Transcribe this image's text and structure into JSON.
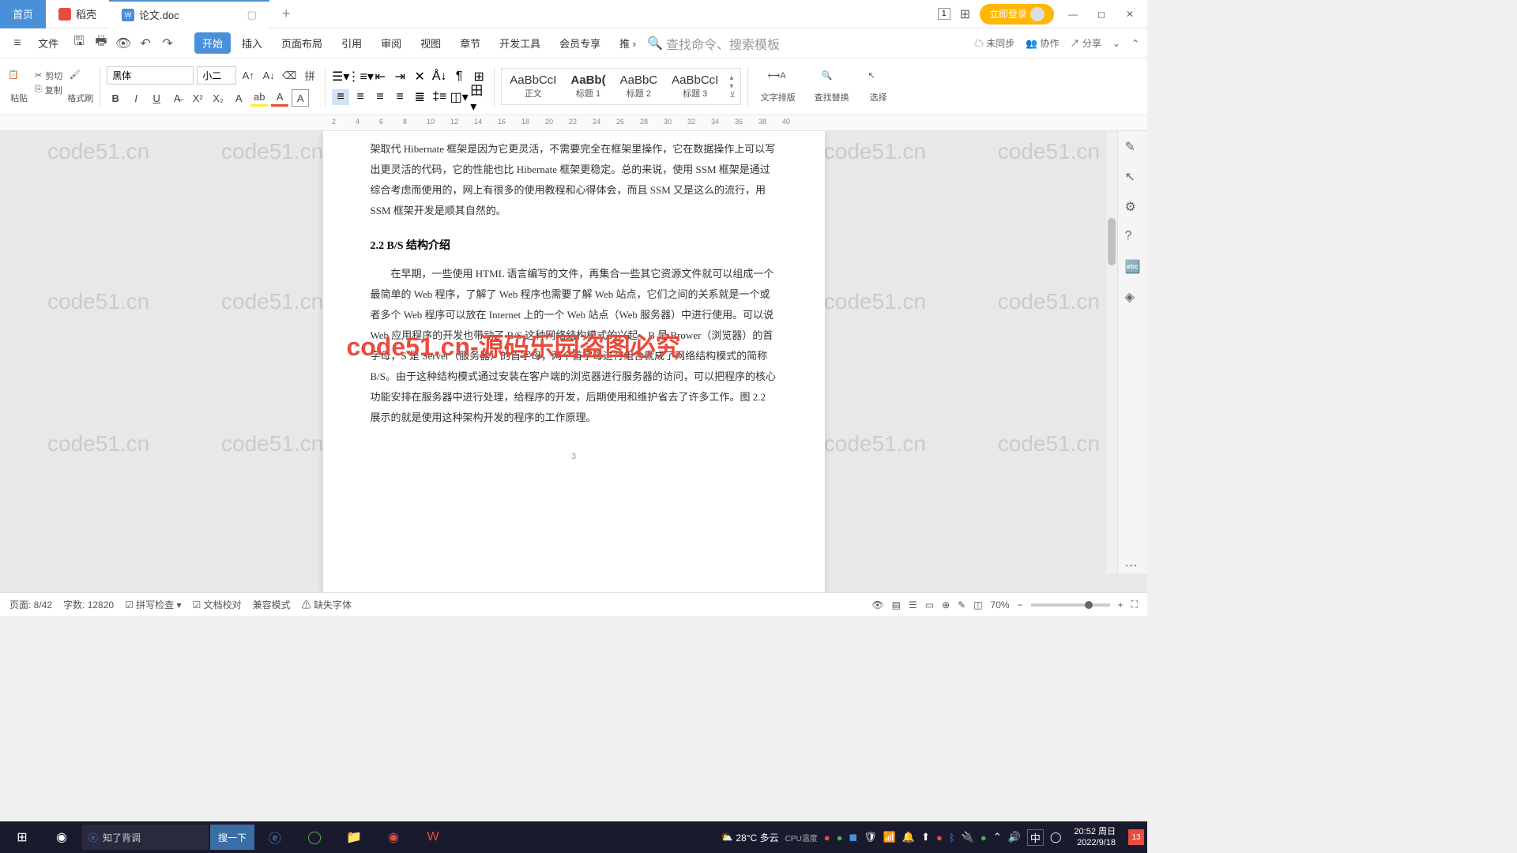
{
  "tabs": {
    "home": "首页",
    "shell": "稻壳",
    "doc": "论文.doc",
    "add": "+"
  },
  "titlebar": {
    "login": "立即登录",
    "window_mode": "1"
  },
  "menubar": {
    "hamburger": "≡",
    "file": "文件",
    "items": [
      "开始",
      "插入",
      "页面布局",
      "引用",
      "审阅",
      "视图",
      "章节",
      "开发工具",
      "会员专享",
      "推"
    ],
    "search_placeholder": "查找命令、搜索模板",
    "sync": "未同步",
    "collab": "协作",
    "share": "分享"
  },
  "ribbon": {
    "paste": "粘贴",
    "cut": "剪切",
    "copy": "复制",
    "format_painter": "格式刷",
    "font_name": "黑体",
    "font_size": "小二",
    "styles": [
      {
        "preview": "AaBbCcI",
        "label": "正文"
      },
      {
        "preview": "AaBb(",
        "label": "标题 1"
      },
      {
        "preview": "AaBbC",
        "label": "标题 2"
      },
      {
        "preview": "AaBbCcI",
        "label": "标题 3"
      }
    ],
    "text_layout": "文字排版",
    "find_replace": "查找替换",
    "select": "选择"
  },
  "ruler_ticks": [
    "2",
    "4",
    "6",
    "8",
    "10",
    "12",
    "14",
    "16",
    "18",
    "20",
    "22",
    "24",
    "26",
    "28",
    "30",
    "32",
    "34",
    "36",
    "38",
    "40"
  ],
  "document": {
    "intro_tail": "架取代 Hibernate 框架是因为它更灵活，不需要完全在框架里操作，它在数据操作上可以写出更灵活的代码，它的性能也比 Hibernate 框架更稳定。总的来说，使用 SSM 框架是通过综合考虑而使用的，网上有很多的使用教程和心得体会，而且 SSM 又是这么的流行，用 SSM 框架开发是顺其自然的。",
    "heading": "2.2 B/S 结构介绍",
    "para1": "在早期，一些使用 HTML 语言编写的文件，再集合一些其它资源文件就可以组成一个最简单的 Web 程序，了解了 Web 程序也需要了解 Web 站点，它们之间的关系就是一个或者多个 Web 程序可以放在 Internet 上的一个 Web 站点（Web 服务器）中进行使用。可以说 Web 应用程序的开发也带动了 B/S 这种网络结构模式的兴起。B 是 Brower（浏览器）的首字母，S 是 Server（服务器）的首字母，两个首字母进行组合就成了网络结构模式的简称 B/S。由于这种结构模式通过安装在客户端的浏览器进行服务器的访问，可以把程序的核心功能安排在服务器中进行处理，给程序的开发，后期使用和维护省去了许多工作。图 2.2 展示的就是使用这种架构开发的程序的工作原理。",
    "page_num": "3"
  },
  "watermark_text": "code51.cn",
  "watermark_red": "code51.cn-源码乐园盗图必究",
  "statusbar": {
    "page": "页面: 8/42",
    "words": "字数: 12820",
    "spell": "拼写检查",
    "proof": "文档校对",
    "compat": "兼容模式",
    "missing_font": "缺失字体",
    "zoom": "70%"
  },
  "taskbar": {
    "search_text": "知了背调",
    "search_btn": "搜一下",
    "weather_temp": "28°C",
    "weather_desc": "多云",
    "cpu_label": "CPU温度",
    "ime": "中",
    "time": "20:52 周日",
    "date": "2022/9/18",
    "notif_count": "13"
  }
}
